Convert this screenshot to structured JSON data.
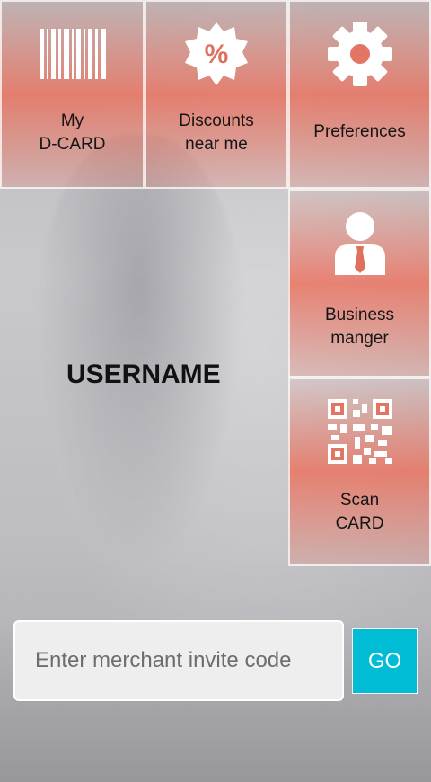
{
  "tiles": {
    "dcard": {
      "label": "My\nD-CARD",
      "icon": "barcode-icon"
    },
    "discounts": {
      "label": "Discounts\nnear me",
      "icon": "percent-badge-icon"
    },
    "preferences": {
      "label": "Preferences",
      "icon": "gear-icon"
    },
    "business": {
      "label": "Business\nmanger",
      "icon": "businessman-icon"
    },
    "scan": {
      "label": "Scan\nCARD",
      "icon": "qr-code-icon"
    }
  },
  "user": {
    "name": "USERNAME"
  },
  "invite": {
    "placeholder": "Enter merchant invite code",
    "value": ""
  },
  "go": {
    "label": "GO"
  },
  "colors": {
    "accent": "#00bcd4",
    "tile": "#ec6e5a"
  }
}
